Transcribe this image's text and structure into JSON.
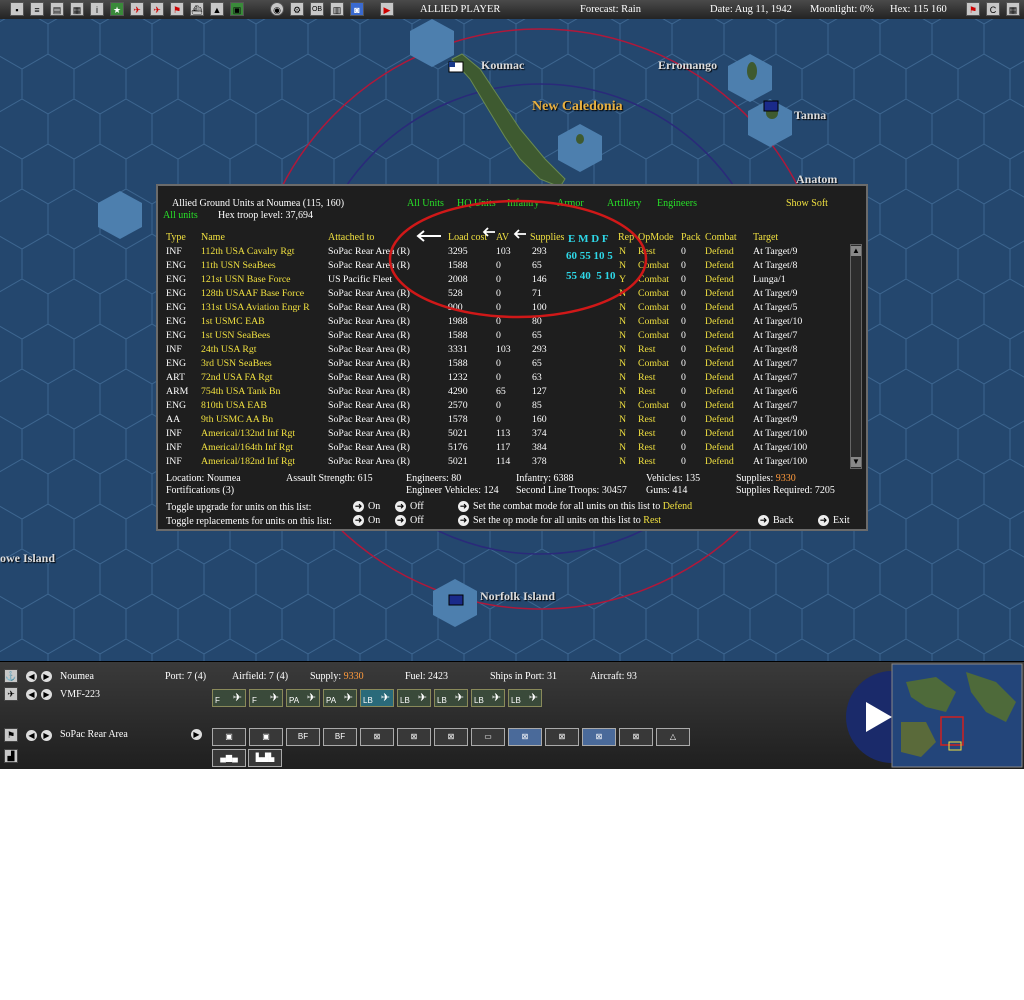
{
  "topbar": {
    "title": "ALLIED PLAYER",
    "forecast": "Forecast: Rain",
    "date": "Date: Aug 11, 1942",
    "moonlight": "Moonlight: 0%",
    "hex": "Hex: 115 160",
    "icon_ob": "OB"
  },
  "map": {
    "labels": {
      "koumac": "Koumac",
      "erromango": "Erromango",
      "new_caledonia": "New Caledonia",
      "tanna": "Tanna",
      "anatom": "Anatom",
      "lord_howe": "owe Island",
      "norfolk": "Norfolk Island"
    },
    "colors": {
      "sea": "#24476e",
      "hexline": "#3d6690",
      "range_circle": "#b0183a",
      "land": "#2f4a2a"
    }
  },
  "dialog": {
    "title": "Allied Ground Units at Noumea (115, 160)",
    "all_units_label": "All units",
    "troop_level": "Hex troop level: 37,694",
    "filters": [
      "All Units",
      "HQ Units",
      "Infantry",
      "Armor",
      "Artillery",
      "Engineers"
    ],
    "show_soft": "Show Soft",
    "columns": [
      "Type",
      "Name",
      "Attached to",
      "Load cost",
      "AV",
      "Supplies",
      "Rep",
      "OpMode",
      "Pack",
      "Combat",
      "Target"
    ],
    "annotation": {
      "emdf": "E M D F",
      "row1": "60 55 10 5",
      "row2": "55 40  5 10"
    },
    "units": [
      {
        "type": "INF",
        "name": "112th USA Cavalry Rgt",
        "attached": "SoPac Rear Area (R)",
        "load": "3295",
        "av": "103",
        "supplies": "293",
        "rep": "N",
        "opmode": "Rest",
        "pack": "0",
        "combat": "Defend",
        "target": "At Target/9"
      },
      {
        "type": "ENG",
        "name": "11th USN SeaBees",
        "attached": "SoPac Rear Area (R)",
        "load": "1588",
        "av": "0",
        "supplies": "65",
        "rep": "N",
        "opmode": "Combat",
        "pack": "0",
        "combat": "Defend",
        "target": "At Target/8"
      },
      {
        "type": "ENG",
        "name": "121st USN Base Force",
        "attached": "US Pacific Fleet",
        "load": "2008",
        "av": "0",
        "supplies": "146",
        "rep": "Y",
        "opmode": "Combat",
        "pack": "0",
        "combat": "Defend",
        "target": "Lunga/1"
      },
      {
        "type": "ENG",
        "name": "128th USAAF Base Force",
        "attached": "SoPac Rear Area (R)",
        "load": "528",
        "av": "0",
        "supplies": "71",
        "rep": "N",
        "opmode": "Combat",
        "pack": "0",
        "combat": "Defend",
        "target": "At Target/9"
      },
      {
        "type": "ENG",
        "name": "131st USA Aviation Engr R",
        "attached": "SoPac Rear Area (R)",
        "load": "900",
        "av": "0",
        "supplies": "100",
        "rep": "N",
        "opmode": "Combat",
        "pack": "0",
        "combat": "Defend",
        "target": "At Target/5"
      },
      {
        "type": "ENG",
        "name": "1st USMC EAB",
        "attached": "SoPac Rear Area (R)",
        "load": "1988",
        "av": "0",
        "supplies": "80",
        "rep": "N",
        "opmode": "Combat",
        "pack": "0",
        "combat": "Defend",
        "target": "At Target/10"
      },
      {
        "type": "ENG",
        "name": "1st USN SeaBees",
        "attached": "SoPac Rear Area (R)",
        "load": "1588",
        "av": "0",
        "supplies": "65",
        "rep": "N",
        "opmode": "Combat",
        "pack": "0",
        "combat": "Defend",
        "target": "At Target/7"
      },
      {
        "type": "INF",
        "name": "24th USA Rgt",
        "attached": "SoPac Rear Area (R)",
        "load": "3331",
        "av": "103",
        "supplies": "293",
        "rep": "N",
        "opmode": "Rest",
        "pack": "0",
        "combat": "Defend",
        "target": "At Target/8"
      },
      {
        "type": "ENG",
        "name": "3rd USN SeaBees",
        "attached": "SoPac Rear Area (R)",
        "load": "1588",
        "av": "0",
        "supplies": "65",
        "rep": "N",
        "opmode": "Combat",
        "pack": "0",
        "combat": "Defend",
        "target": "At Target/7"
      },
      {
        "type": "ART",
        "name": "72nd USA FA Rgt",
        "attached": "SoPac Rear Area (R)",
        "load": "1232",
        "av": "0",
        "supplies": "63",
        "rep": "N",
        "opmode": "Rest",
        "pack": "0",
        "combat": "Defend",
        "target": "At Target/7"
      },
      {
        "type": "ARM",
        "name": "754th USA Tank Bn",
        "attached": "SoPac Rear Area (R)",
        "load": "4290",
        "av": "65",
        "supplies": "127",
        "rep": "N",
        "opmode": "Rest",
        "pack": "0",
        "combat": "Defend",
        "target": "At Target/6"
      },
      {
        "type": "ENG",
        "name": "810th USA EAB",
        "attached": "SoPac Rear Area (R)",
        "load": "2570",
        "av": "0",
        "supplies": "85",
        "rep": "N",
        "opmode": "Combat",
        "pack": "0",
        "combat": "Defend",
        "target": "At Target/7"
      },
      {
        "type": "AA",
        "name": "9th USMC AA Bn",
        "attached": "SoPac Rear Area (R)",
        "load": "1578",
        "av": "0",
        "supplies": "160",
        "rep": "N",
        "opmode": "Rest",
        "pack": "0",
        "combat": "Defend",
        "target": "At Target/9"
      },
      {
        "type": "INF",
        "name": "Americal/132nd Inf Rgt",
        "attached": "SoPac Rear Area (R)",
        "load": "5021",
        "av": "113",
        "supplies": "374",
        "rep": "N",
        "opmode": "Rest",
        "pack": "0",
        "combat": "Defend",
        "target": "At Target/100"
      },
      {
        "type": "INF",
        "name": "Americal/164th Inf Rgt",
        "attached": "SoPac Rear Area (R)",
        "load": "5176",
        "av": "117",
        "supplies": "384",
        "rep": "N",
        "opmode": "Rest",
        "pack": "0",
        "combat": "Defend",
        "target": "At Target/100"
      },
      {
        "type": "INF",
        "name": "Americal/182nd Inf Rgt",
        "attached": "SoPac Rear Area (R)",
        "load": "5021",
        "av": "114",
        "supplies": "378",
        "rep": "N",
        "opmode": "Rest",
        "pack": "0",
        "combat": "Defend",
        "target": "At Target/100"
      }
    ],
    "summary": {
      "location": "Location: Noumea",
      "fortifications": "Fortifications (3)",
      "assault": "Assault Strength: 615",
      "engineers": "Engineers: 80",
      "engineer_vehicles": "Engineer Vehicles: 124",
      "infantry": "Infantry: 6388",
      "second_line": "Second Line Troops: 30457",
      "vehicles": "Vehicles: 135",
      "guns": "Guns: 414",
      "supplies_label": "Supplies:",
      "supplies_value": "9330",
      "supplies_required": "Supplies Required: 7205"
    },
    "controls": {
      "toggle_upgrade": "Toggle upgrade for units on this list:",
      "toggle_replacements": "Toggle replacements for units on this list:",
      "on": "On",
      "off": "Off",
      "set_combat_mode": "Set the combat mode for all units on this list to",
      "combat_mode_value": "Defend",
      "set_op_mode": "Set the op mode for all units on this list to",
      "op_mode_value": "Rest",
      "back": "Back",
      "exit": "Exit"
    }
  },
  "bottom": {
    "base": "Noumea",
    "port": "Port: 7 (4)",
    "airfield": "Airfield: 7 (4)",
    "supply_label": "Supply:",
    "supply_value": "9330",
    "fuel": "Fuel: 2423",
    "ships": "Ships in Port: 31",
    "aircraft": "Aircraft: 93",
    "squadron": "VMF-223",
    "hq": "SoPac Rear Area",
    "air_buttons": [
      "F",
      "F",
      "PA",
      "PA",
      "LB",
      "LB",
      "LB",
      "LB",
      "LB"
    ],
    "unit_buttons": [
      "",
      "",
      "BF",
      "BF",
      "",
      "",
      "",
      "",
      "",
      "",
      "",
      "",
      ""
    ]
  }
}
